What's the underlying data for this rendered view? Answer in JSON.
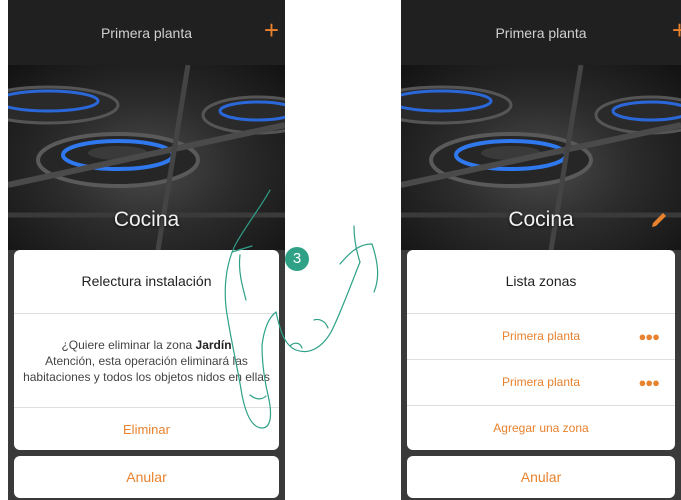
{
  "left_screen": {
    "header": {
      "title": "Primera planta",
      "add_icon": "plus-icon"
    },
    "room": {
      "label": "Cocina"
    },
    "dialog": {
      "title": "Relectura instalación",
      "message_prefix": "¿Quiere eliminar la zona",
      "zone_name": "Jardín",
      "message_body": "Atención, esta operación eliminará las habitaciones y todos los objetos nidos en ellas",
      "action_label": "Eliminar"
    },
    "cancel_label": "Anular"
  },
  "step_badge": "3",
  "right_screen": {
    "header": {
      "title": "Primera planta",
      "add_icon": "plus-icon"
    },
    "room": {
      "label": "Cocina",
      "edit_icon": "pencil-icon"
    },
    "dialog": {
      "title": "Lista zonas",
      "zones": [
        {
          "label": "Primera planta",
          "more_icon": "more-dots-icon"
        },
        {
          "label": "Primera planta",
          "more_icon": "more-dots-icon"
        }
      ],
      "add_label": "Agregar una zona"
    },
    "cancel_label": "Anular"
  },
  "colors": {
    "accent": "#e8822e",
    "badge": "#2ea187",
    "header": "#202020"
  }
}
